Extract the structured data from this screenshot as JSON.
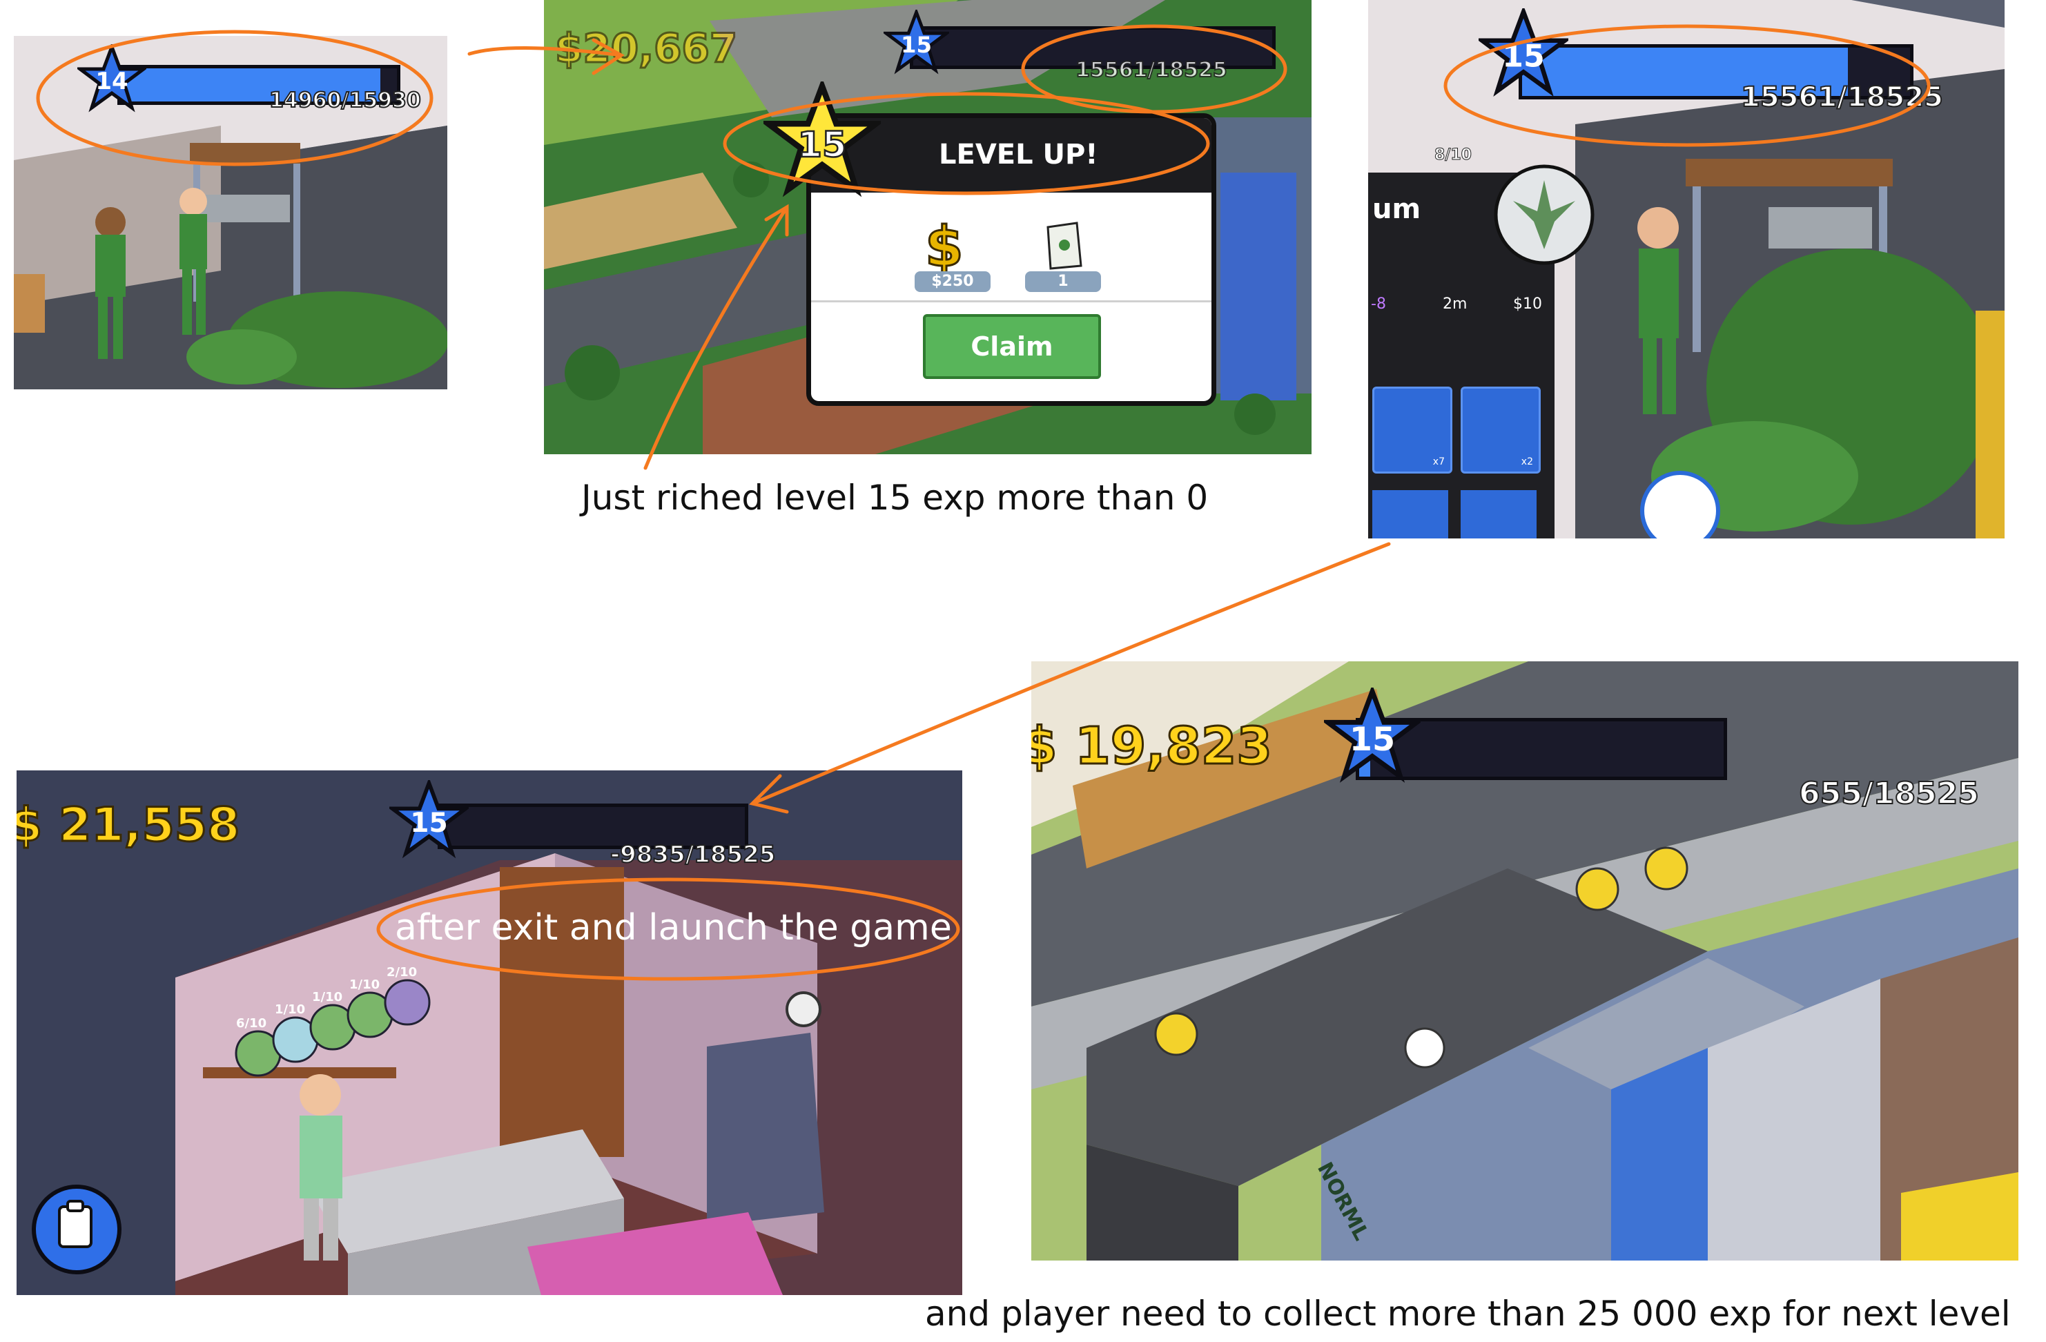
{
  "panels": {
    "p1": {
      "level": "14",
      "xp_text": "14960/15930",
      "xp_progress": 0.94
    },
    "p2": {
      "money": "$20,667",
      "hud_level": "15",
      "hud_xp_text": "15561/18525",
      "popup": {
        "level": "15",
        "title": "LEVEL UP!",
        "reward_cash": "$250",
        "reward_item": "1",
        "claim_label": "Claim"
      }
    },
    "p3": {
      "level": "15",
      "xp_text": "15561/18525",
      "xp_progress": 0.84,
      "side_panel": {
        "capacity": "8/10",
        "title_fragment": "um",
        "stat_left": "-8",
        "stat_time": "2m",
        "stat_price": "$10",
        "item1_count": "x7",
        "item2_count": "x2"
      }
    },
    "p4": {
      "money": "$ 21,558",
      "level": "15",
      "xp_text": "-9835/18525",
      "xp_progress": 0.0,
      "jars": [
        "6/10",
        "1/10",
        "1/10",
        "1/10",
        "2/10"
      ],
      "annotation": "after exit and launch the game"
    },
    "p5": {
      "money": "$ 19,823",
      "level": "15",
      "xp_text": "655/18525",
      "xp_progress": 0.03,
      "building_sign": "NORML"
    }
  },
  "captions": {
    "c1": "Just riched level 15 exp more than 0",
    "c2": "and player need to collect more than 25 000 exp for next level"
  },
  "colors": {
    "annotation": "#f57a1f",
    "xp_fill": "#3d84f5",
    "star_blue": "#2f6fe8",
    "star_yellow": "#ffe63a",
    "claim_green": "#58b55a",
    "money": "#ffd21c"
  }
}
